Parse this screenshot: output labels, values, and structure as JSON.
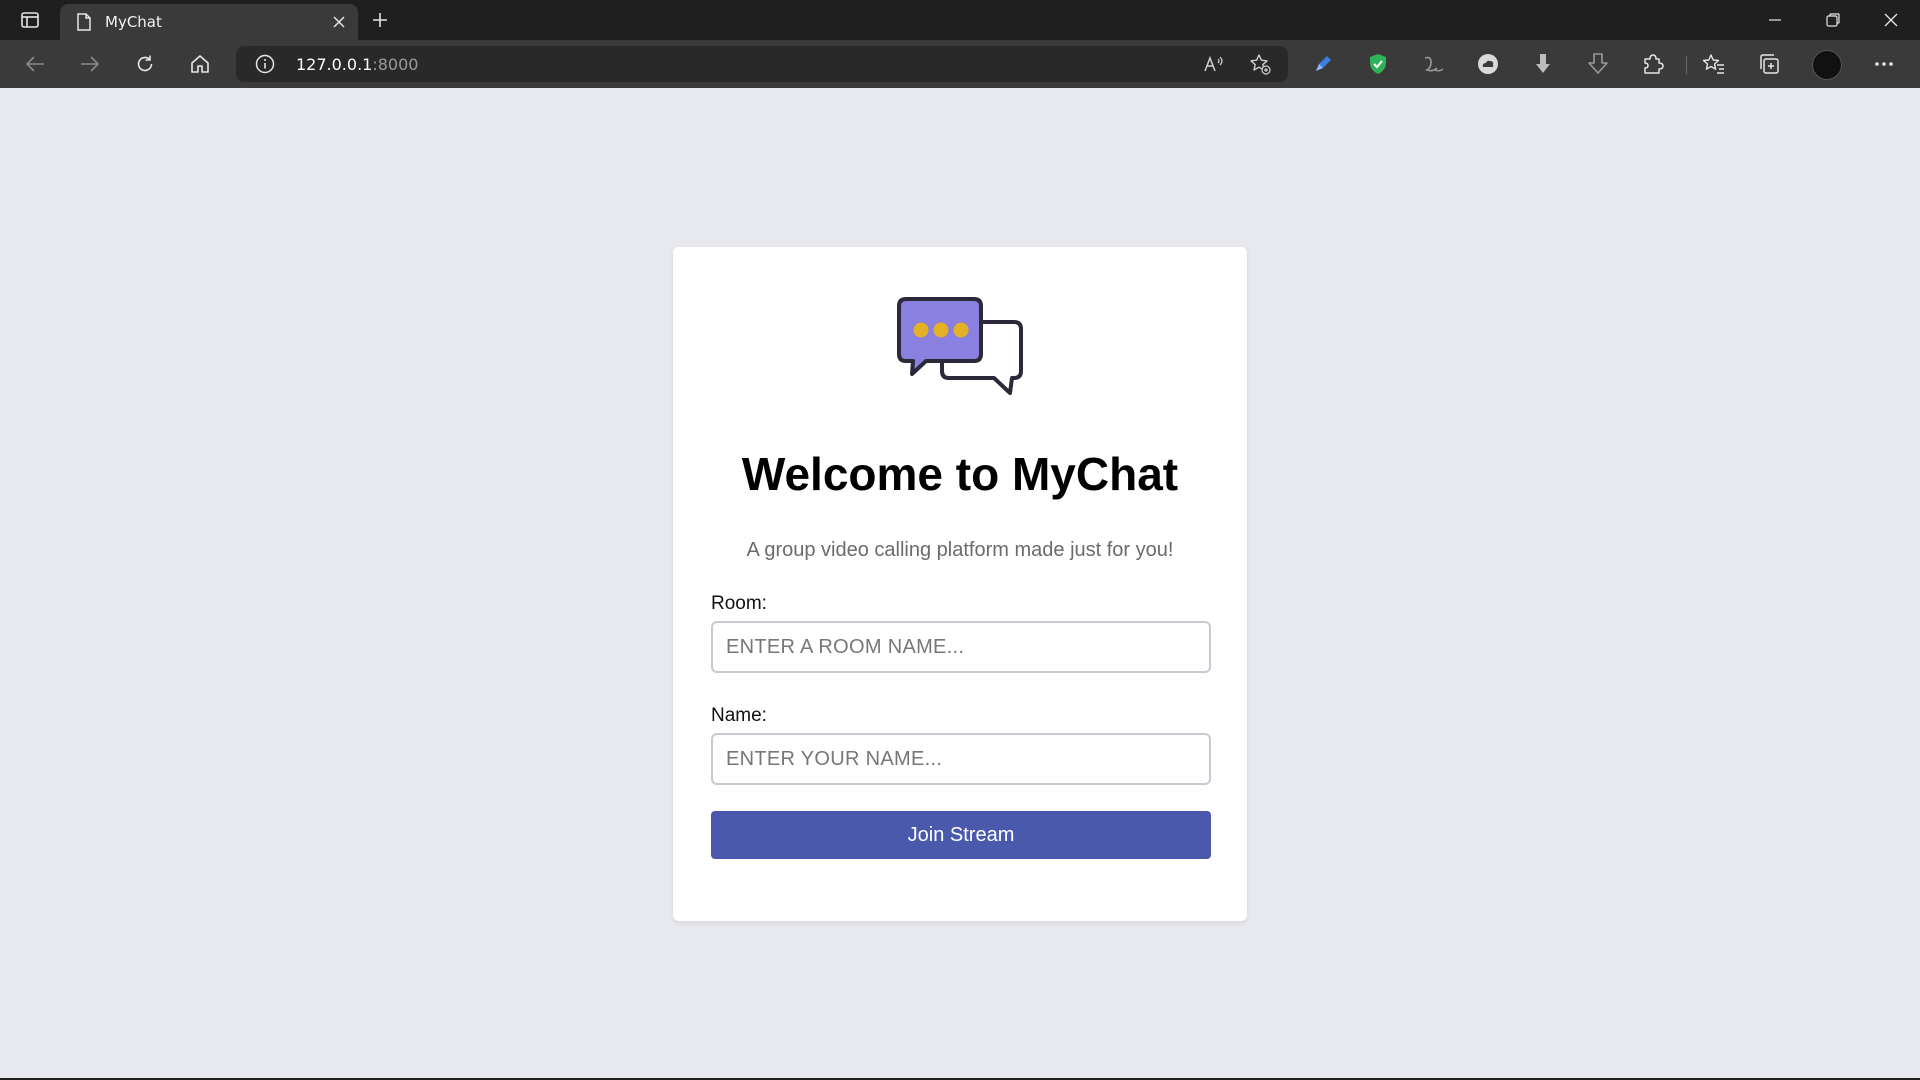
{
  "browser": {
    "tab_title": "MyChat",
    "address_host": "127.0.0.1",
    "address_port": ":8000"
  },
  "page": {
    "heading": "Welcome to MyChat",
    "tagline": "A group video calling platform made just for you!",
    "room_label": "Room:",
    "room_placeholder": "ENTER A ROOM NAME...",
    "room_value": "",
    "name_label": "Name:",
    "name_placeholder": "ENTER YOUR NAME...",
    "name_value": "",
    "join_button": "Join Stream"
  },
  "colors": {
    "page_background": "#e8e9ee",
    "join_button": "#4b59ad",
    "logo_bubble": "#8a80e0",
    "logo_dots": "#e3b224"
  },
  "icons": [
    "sidebar-toggle-icon",
    "page-icon",
    "close-icon",
    "plus-icon",
    "minimize-icon",
    "restore-icon",
    "back-arrow-icon",
    "forward-arrow-icon",
    "refresh-icon",
    "home-icon",
    "info-icon",
    "read-aloud-icon",
    "favorite-add-icon",
    "pen-extension-icon",
    "shield-extension-icon",
    "script-extension-icon",
    "cloud-extension-icon",
    "download-extension-icon",
    "download-arrow-icon",
    "puzzle-icon",
    "favorites-icon",
    "collections-icon",
    "profile-avatar",
    "more-icon",
    "chat-bubbles-icon"
  ]
}
